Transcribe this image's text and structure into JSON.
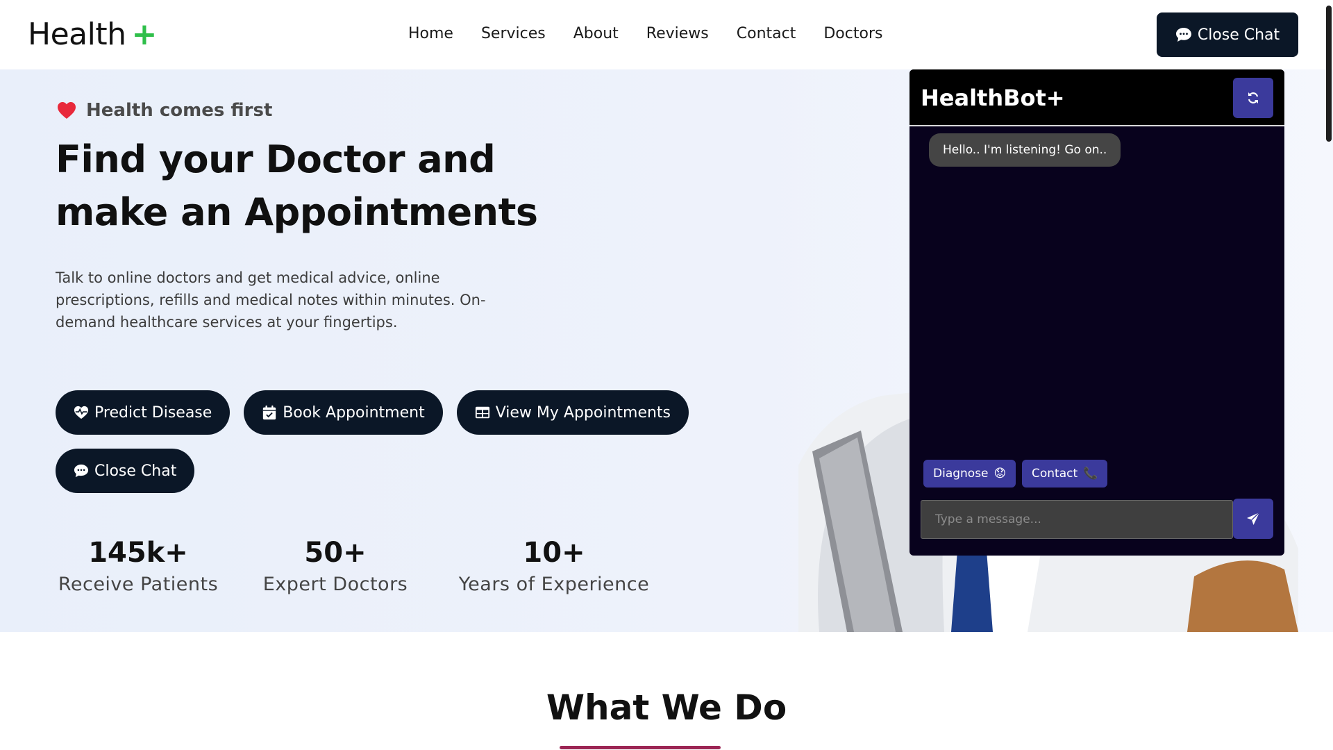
{
  "header": {
    "logo_text": "Health",
    "logo_plus": "+",
    "nav": [
      "Home",
      "Services",
      "About",
      "Reviews",
      "Contact",
      "Doctors"
    ],
    "chat_button": "Close Chat"
  },
  "hero": {
    "tagline": "Health comes first",
    "title_line1": "Find your Doctor and",
    "title_line2": "make an Appointments",
    "description": "Talk to online doctors and get medical advice, online prescriptions, refills and medical notes within minutes. On-demand healthcare services at your fingertips.",
    "buttons": {
      "predict": "Predict Disease",
      "book": "Book Appointment",
      "view": "View My Appointments",
      "close_chat": "Close Chat"
    },
    "stats": [
      {
        "num": "145k+",
        "label": "Receive Patients"
      },
      {
        "num": "50+",
        "label": "Expert Doctors"
      },
      {
        "num": "10+",
        "label": "Years of Experience"
      }
    ]
  },
  "chat": {
    "title": "HealthBot+",
    "bot_message": "Hello.. I'm listening! Go on..",
    "quick_replies": {
      "diagnose": "Diagnose",
      "diagnose_emoji": "😟",
      "contact": "Contact",
      "contact_emoji": "📞"
    },
    "input_placeholder": "Type a message..."
  },
  "section": {
    "title": "What We Do"
  },
  "colors": {
    "primary_dark": "#0b1727",
    "accent_green": "#2fbf4a",
    "chat_bg": "#08021d",
    "chat_accent": "#3b3a9c",
    "underline": "#9c2554"
  }
}
